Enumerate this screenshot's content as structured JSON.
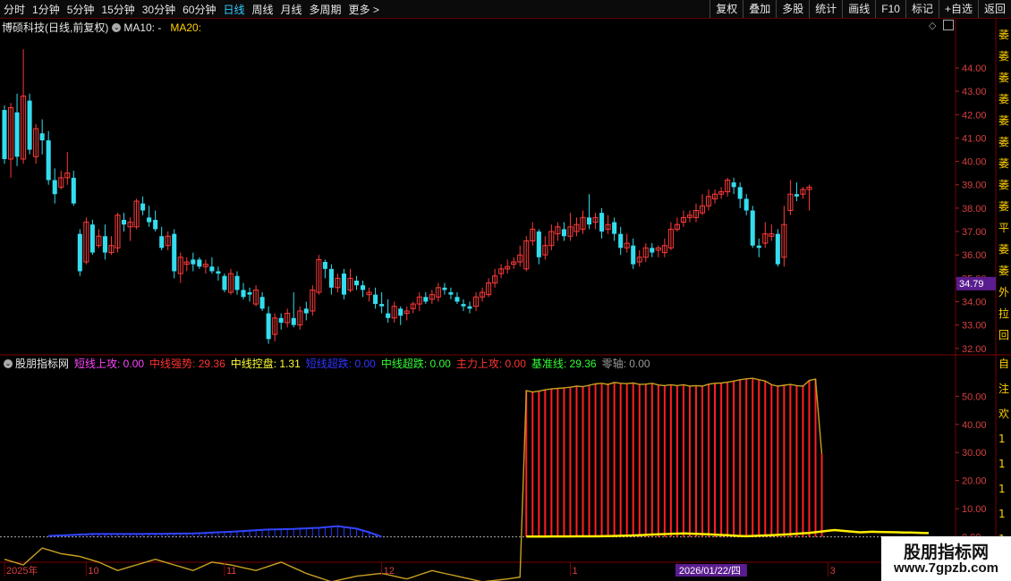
{
  "toolbar": {
    "periods": [
      "分时",
      "1分钟",
      "5分钟",
      "15分钟",
      "30分钟",
      "60分钟",
      "日线",
      "周线",
      "月线",
      "多周期",
      "更多 >"
    ],
    "active_period": "日线",
    "right_buttons": [
      "复权",
      "叠加",
      "多股",
      "统计",
      "画线",
      "F10",
      "标记",
      "+自选",
      "返回"
    ]
  },
  "main_header": {
    "title": "博硕科技(日线,前复权)",
    "ma10": "MA10: -",
    "ma20": "MA20:"
  },
  "price_label": "34.79",
  "indicator_header": {
    "name": "股朋指标网",
    "items": [
      {
        "label": "短线上攻: 0.00",
        "color": "#ff44ff"
      },
      {
        "label": "中线强势: 29.36",
        "color": "#ff3333"
      },
      {
        "label": "中线控盘: 1.31",
        "color": "#ffff33"
      },
      {
        "label": "短线超跌: 0.00",
        "color": "#3333ff"
      },
      {
        "label": "中线超跌: 0.00",
        "color": "#33ff33"
      },
      {
        "label": "主力上攻: 0.00",
        "color": "#ff3333"
      },
      {
        "label": "基准线: 29.36",
        "color": "#33ff33"
      },
      {
        "label": "零轴: 0.00",
        "color": "#9a9a9a"
      }
    ]
  },
  "x_axis": {
    "labels": [
      {
        "text": "2025年",
        "idx": 0
      },
      {
        "text": "10",
        "idx": 13
      },
      {
        "text": "11",
        "idx": 35
      },
      {
        "text": "12",
        "idx": 60
      },
      {
        "text": "1",
        "idx": 90
      },
      {
        "text": "2026/01/22/四",
        "idx": 107,
        "hl": true
      },
      {
        "text": "3",
        "idx": 131
      }
    ]
  },
  "right_stub": {
    "main": [
      "萎",
      "萎",
      "萎",
      "萎",
      "萎",
      "萎",
      "萎",
      "萎",
      "萎",
      "平",
      "萎",
      "萎",
      "外",
      "拉",
      "回"
    ],
    "ind": [
      "自",
      "注",
      "欢",
      "1",
      "1",
      "1",
      "1",
      "1",
      "1",
      "1"
    ]
  },
  "chart_data": {
    "type": "candlestick",
    "main": {
      "ylim": [
        31.8,
        45.3
      ],
      "yticks": [
        "44.00",
        "43.00",
        "42.00",
        "41.00",
        "40.00",
        "39.00",
        "38.00",
        "37.00",
        "36.00",
        "35.00",
        "34.00",
        "33.00",
        "32.00"
      ],
      "candles": [
        [
          42.2,
          40.1,
          42.4,
          39.9
        ],
        [
          40.1,
          42.3,
          42.5,
          39.3
        ],
        [
          42.1,
          40.2,
          42.9,
          39.8
        ],
        [
          40.1,
          42.8,
          44.8,
          39.9
        ],
        [
          42.6,
          40.5,
          42.9,
          40.3
        ],
        [
          40.2,
          41.4,
          41.6,
          39.9
        ],
        [
          41.2,
          40.9,
          41.8,
          40.3
        ],
        [
          40.9,
          39.2,
          41.3,
          39.0
        ],
        [
          39.2,
          38.6,
          39.7,
          38.2
        ],
        [
          38.9,
          39.3,
          39.6,
          38.8
        ],
        [
          39.3,
          39.5,
          40.4,
          39.0
        ],
        [
          39.3,
          38.2,
          39.6,
          38.1
        ],
        [
          36.9,
          35.3,
          37.1,
          35.1
        ],
        [
          35.7,
          37.4,
          37.6,
          35.6
        ],
        [
          37.3,
          36.1,
          37.5,
          36.0
        ],
        [
          36.4,
          36.8,
          37.1,
          36.3
        ],
        [
          36.8,
          36.1,
          37.3,
          35.8
        ],
        [
          36.1,
          36.4,
          36.8,
          36.0
        ],
        [
          36.3,
          37.7,
          37.8,
          36.1
        ],
        [
          37.5,
          37.3,
          37.8,
          37.0
        ],
        [
          37.2,
          37.4,
          37.6,
          36.6
        ],
        [
          37.2,
          38.3,
          38.4,
          37.1
        ],
        [
          38.2,
          37.9,
          38.5,
          37.7
        ],
        [
          37.6,
          37.4,
          38.1,
          37.2
        ],
        [
          37.5,
          37.1,
          37.9,
          37.0
        ],
        [
          36.8,
          36.3,
          37.2,
          36.2
        ],
        [
          36.4,
          36.8,
          37.0,
          36.2
        ],
        [
          36.9,
          35.3,
          37.1,
          35.0
        ],
        [
          35.2,
          35.9,
          36.1,
          34.8
        ],
        [
          35.6,
          35.7,
          35.9,
          35.3
        ],
        [
          35.8,
          35.6,
          36.1,
          35.3
        ],
        [
          35.8,
          35.5,
          35.9,
          35.4
        ],
        [
          35.5,
          35.6,
          35.8,
          35.2
        ],
        [
          35.5,
          35.3,
          35.9,
          35.2
        ],
        [
          35.3,
          35.2,
          35.5,
          34.9
        ],
        [
          35.1,
          34.5,
          35.2,
          34.4
        ],
        [
          34.4,
          35.2,
          35.4,
          34.3
        ],
        [
          35.1,
          34.5,
          35.3,
          34.3
        ],
        [
          34.5,
          34.2,
          34.8,
          34.1
        ],
        [
          34.4,
          34.3,
          34.6,
          34.0
        ],
        [
          33.9,
          34.5,
          34.7,
          33.8
        ],
        [
          34.2,
          33.7,
          34.4,
          33.6
        ],
        [
          33.5,
          32.4,
          33.8,
          32.2
        ],
        [
          32.6,
          33.3,
          33.5,
          32.3
        ],
        [
          33.3,
          33.1,
          33.5,
          32.8
        ],
        [
          33.1,
          33.5,
          33.7,
          32.9
        ],
        [
          33.3,
          33.0,
          34.4,
          32.9
        ],
        [
          33.0,
          33.6,
          33.8,
          32.8
        ],
        [
          33.7,
          33.5,
          34.0,
          33.2
        ],
        [
          33.6,
          34.5,
          34.7,
          33.4
        ],
        [
          34.4,
          35.8,
          36.0,
          34.3
        ],
        [
          35.7,
          35.4,
          35.8,
          35.0
        ],
        [
          35.4,
          34.6,
          35.6,
          34.3
        ],
        [
          34.6,
          35.0,
          35.2,
          34.4
        ],
        [
          35.2,
          34.3,
          35.4,
          34.1
        ],
        [
          34.5,
          35.0,
          35.4,
          34.4
        ],
        [
          34.9,
          34.7,
          35.1,
          34.5
        ],
        [
          34.7,
          34.5,
          34.9,
          34.2
        ],
        [
          34.3,
          34.4,
          34.6,
          34.0
        ],
        [
          34.3,
          33.9,
          34.6,
          33.7
        ],
        [
          33.9,
          33.8,
          34.4,
          33.5
        ],
        [
          33.5,
          33.3,
          34.1,
          33.1
        ],
        [
          33.3,
          33.8,
          34.0,
          33.1
        ],
        [
          33.7,
          33.4,
          33.8,
          33.0
        ],
        [
          33.5,
          33.6,
          33.8,
          33.2
        ],
        [
          33.7,
          33.9,
          34.0,
          33.5
        ],
        [
          33.9,
          34.2,
          34.4,
          33.6
        ],
        [
          34.2,
          34.0,
          34.4,
          33.9
        ],
        [
          34.1,
          34.3,
          34.5,
          33.9
        ],
        [
          34.2,
          34.6,
          34.8,
          34.0
        ],
        [
          34.6,
          34.5,
          34.8,
          34.3
        ],
        [
          34.4,
          34.3,
          34.6,
          34.1
        ],
        [
          34.2,
          34.0,
          34.4,
          33.9
        ],
        [
          33.9,
          33.8,
          34.1,
          33.6
        ],
        [
          33.8,
          33.7,
          34.0,
          33.5
        ],
        [
          33.8,
          34.2,
          34.4,
          33.6
        ],
        [
          34.2,
          34.4,
          34.6,
          34.0
        ],
        [
          34.3,
          34.8,
          35.0,
          34.2
        ],
        [
          34.8,
          35.1,
          35.4,
          34.6
        ],
        [
          35.2,
          35.4,
          35.6,
          35.0
        ],
        [
          35.4,
          35.5,
          35.8,
          35.2
        ],
        [
          35.6,
          35.7,
          35.9,
          35.4
        ],
        [
          35.7,
          36.0,
          36.4,
          35.5
        ],
        [
          35.4,
          36.6,
          36.8,
          35.3
        ],
        [
          36.6,
          37.1,
          37.4,
          36.4
        ],
        [
          37.0,
          35.9,
          37.1,
          35.6
        ],
        [
          36.0,
          36.4,
          36.8,
          35.8
        ],
        [
          36.4,
          37.0,
          37.3,
          36.2
        ],
        [
          36.9,
          37.2,
          37.4,
          36.6
        ],
        [
          37.1,
          36.8,
          37.4,
          36.6
        ],
        [
          36.8,
          37.2,
          37.8,
          36.6
        ],
        [
          37.0,
          37.3,
          37.6,
          36.8
        ],
        [
          37.1,
          37.6,
          37.9,
          36.9
        ],
        [
          37.6,
          37.3,
          38.6,
          37.1
        ],
        [
          37.4,
          37.6,
          37.8,
          37.1
        ],
        [
          37.8,
          37.0,
          38.0,
          36.7
        ],
        [
          37.1,
          37.3,
          37.7,
          36.9
        ],
        [
          37.4,
          36.9,
          37.6,
          36.6
        ],
        [
          36.9,
          36.3,
          37.2,
          36.0
        ],
        [
          36.3,
          36.5,
          36.9,
          36.1
        ],
        [
          36.4,
          35.6,
          36.7,
          35.4
        ],
        [
          35.7,
          35.9,
          36.2,
          35.5
        ],
        [
          35.9,
          36.3,
          36.5,
          35.7
        ],
        [
          36.3,
          36.1,
          36.5,
          35.9
        ],
        [
          36.2,
          36.3,
          36.4,
          35.9
        ],
        [
          36.1,
          36.4,
          36.7,
          35.9
        ],
        [
          36.3,
          37.1,
          37.4,
          36.2
        ],
        [
          37.1,
          37.3,
          37.6,
          37.0
        ],
        [
          37.4,
          37.6,
          37.9,
          37.2
        ],
        [
          37.6,
          37.7,
          37.9,
          37.4
        ],
        [
          37.6,
          37.9,
          38.2,
          37.4
        ],
        [
          37.8,
          38.1,
          38.6,
          37.7
        ],
        [
          38.1,
          38.5,
          38.8,
          37.9
        ],
        [
          38.4,
          38.6,
          38.8,
          38.2
        ],
        [
          38.6,
          38.7,
          38.9,
          38.4
        ],
        [
          38.7,
          39.2,
          39.3,
          38.5
        ],
        [
          39.1,
          38.9,
          39.3,
          38.6
        ],
        [
          38.9,
          38.4,
          39.1,
          38.0
        ],
        [
          38.4,
          37.9,
          38.6,
          37.7
        ],
        [
          37.9,
          36.4,
          38.1,
          36.3
        ],
        [
          36.4,
          36.3,
          36.7,
          35.9
        ],
        [
          36.5,
          36.9,
          37.4,
          36.3
        ],
        [
          36.8,
          36.9,
          37.3,
          36.6
        ],
        [
          36.9,
          35.6,
          37.1,
          35.5
        ],
        [
          35.9,
          37.3,
          38.1,
          35.5
        ],
        [
          37.9,
          38.6,
          39.2,
          37.7
        ],
        [
          38.6,
          38.5,
          39.1,
          38.3
        ],
        [
          38.6,
          38.8,
          38.9,
          38.4
        ],
        [
          38.8,
          38.9,
          39.0,
          37.9
        ]
      ]
    },
    "indicator": {
      "ylim": [
        -3,
        59
      ],
      "yticks": [
        "50.00",
        "40.00",
        "30.00",
        "20.00",
        "10.00",
        "0.00"
      ],
      "red_start": 83,
      "red_bars": [
        52.0,
        51.5,
        51.8,
        52.3,
        52.6,
        52.8,
        53.0,
        53.2,
        53.6,
        53.4,
        53.9,
        54.4,
        54.6,
        54.2,
        54.9,
        54.6,
        54.5,
        54.7,
        54.2,
        54.3,
        54.6,
        54.0,
        53.8,
        54.1,
        53.8,
        54.1,
        53.6,
        53.8,
        53.6,
        54.3,
        54.6,
        54.7,
        55.0,
        55.4,
        55.9,
        56.2,
        56.4,
        55.9,
        55.4,
        54.1,
        53.6,
        53.9,
        54.2,
        53.8,
        53.6,
        55.6,
        56.1,
        29.4
      ],
      "blue_hump": [
        [
          7,
          0.3
        ],
        [
          10,
          0.6
        ],
        [
          14,
          1.0
        ],
        [
          18,
          1.0
        ],
        [
          22,
          1.0
        ],
        [
          30,
          1.2
        ],
        [
          36,
          1.8
        ],
        [
          42,
          2.6
        ],
        [
          46,
          2.8
        ],
        [
          50,
          3.2
        ],
        [
          53,
          3.8
        ],
        [
          56,
          2.9
        ],
        [
          58,
          1.6
        ],
        [
          60,
          0
        ]
      ],
      "yellow": [
        [
          83,
          0.1
        ],
        [
          95,
          0.2
        ],
        [
          100,
          0.5
        ],
        [
          104,
          0.9
        ],
        [
          108,
          1.2
        ],
        [
          112,
          0.9
        ],
        [
          118,
          0.2
        ],
        [
          124,
          0.8
        ],
        [
          128,
          1.4
        ],
        [
          132,
          2.4
        ],
        [
          134,
          2.0
        ],
        [
          136,
          1.6
        ],
        [
          138,
          1.8
        ],
        [
          142,
          1.6
        ],
        [
          146,
          1.4
        ],
        [
          147,
          1.31
        ]
      ],
      "lower_line": [
        [
          0,
          -8
        ],
        [
          3,
          -10
        ],
        [
          6,
          -4
        ],
        [
          9,
          -6
        ],
        [
          12,
          -7
        ],
        [
          15,
          -9
        ],
        [
          18,
          -12
        ],
        [
          21,
          -10
        ],
        [
          24,
          -8
        ],
        [
          27,
          -10
        ],
        [
          30,
          -12
        ],
        [
          33,
          -9
        ],
        [
          36,
          -10
        ],
        [
          40,
          -12
        ],
        [
          44,
          -9
        ],
        [
          48,
          -13
        ],
        [
          52,
          -16
        ],
        [
          56,
          -14
        ],
        [
          60,
          -13
        ],
        [
          64,
          -15
        ],
        [
          68,
          -12
        ],
        [
          72,
          -14
        ],
        [
          76,
          -16
        ],
        [
          80,
          -15
        ],
        [
          83,
          -14
        ],
        [
          87,
          -16
        ],
        [
          90,
          -14
        ],
        [
          95,
          -12
        ],
        [
          100,
          -11
        ],
        [
          104,
          -12
        ],
        [
          108,
          -15
        ],
        [
          112,
          -18
        ],
        [
          116,
          -17
        ],
        [
          120,
          -15
        ],
        [
          124,
          -14
        ],
        [
          128,
          -13
        ],
        [
          132,
          -16
        ],
        [
          136,
          -13
        ],
        [
          140,
          -11
        ],
        [
          143,
          -12
        ],
        [
          145,
          -13
        ],
        [
          146,
          -12
        ],
        [
          147,
          -12
        ]
      ]
    }
  }
}
